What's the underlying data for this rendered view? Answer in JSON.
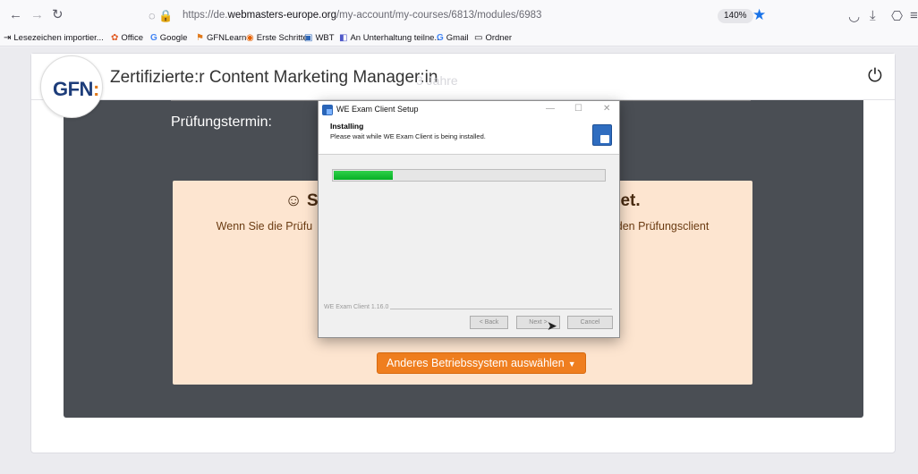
{
  "browser": {
    "url_prefix": "https://de.",
    "url_domain": "webmasters-europe.org",
    "url_path": "/my-account/my-courses/6813/modules/6983",
    "zoom": "140%"
  },
  "bookmarks": [
    {
      "icon": "⇥",
      "label": "Lesezeichen importier..."
    },
    {
      "icon": "✿",
      "label": "Office"
    },
    {
      "icon": "G",
      "label": "Google"
    },
    {
      "icon": "⚑",
      "label": "GFNLearn"
    },
    {
      "icon": "◉",
      "label": "Erste Schritte"
    },
    {
      "icon": "▣",
      "label": "WBT"
    },
    {
      "icon": "◧",
      "label": "An Unterhaltung teilne..."
    },
    {
      "icon": "G",
      "label": "Gmail"
    },
    {
      "icon": "▭",
      "label": "Ordner"
    }
  ],
  "header": {
    "logo": "GFN",
    "course_title": "Zertifizierte:r Content Marketing Manager:in",
    "ghost_text": "3 Jahre"
  },
  "panel": {
    "exam_date_label": "Prüfungstermin:"
  },
  "card": {
    "headline_left": "☺ Sie h",
    "headline_right": "gemeldet.",
    "text_left": "Wenn Sie die Prüfu",
    "text_right": "r den Prüfungsclient",
    "os_button": "Anderes Betriebssystem auswählen"
  },
  "dialog": {
    "title": "WE Exam Client Setup",
    "header_title": "Installing",
    "header_sub": "Please wait while WE Exam Client is being installed.",
    "progress": 0.22,
    "version": "WE Exam Client 1.16.0",
    "back_label": "< Back",
    "next_label": "Next >",
    "cancel_label": "Cancel"
  }
}
